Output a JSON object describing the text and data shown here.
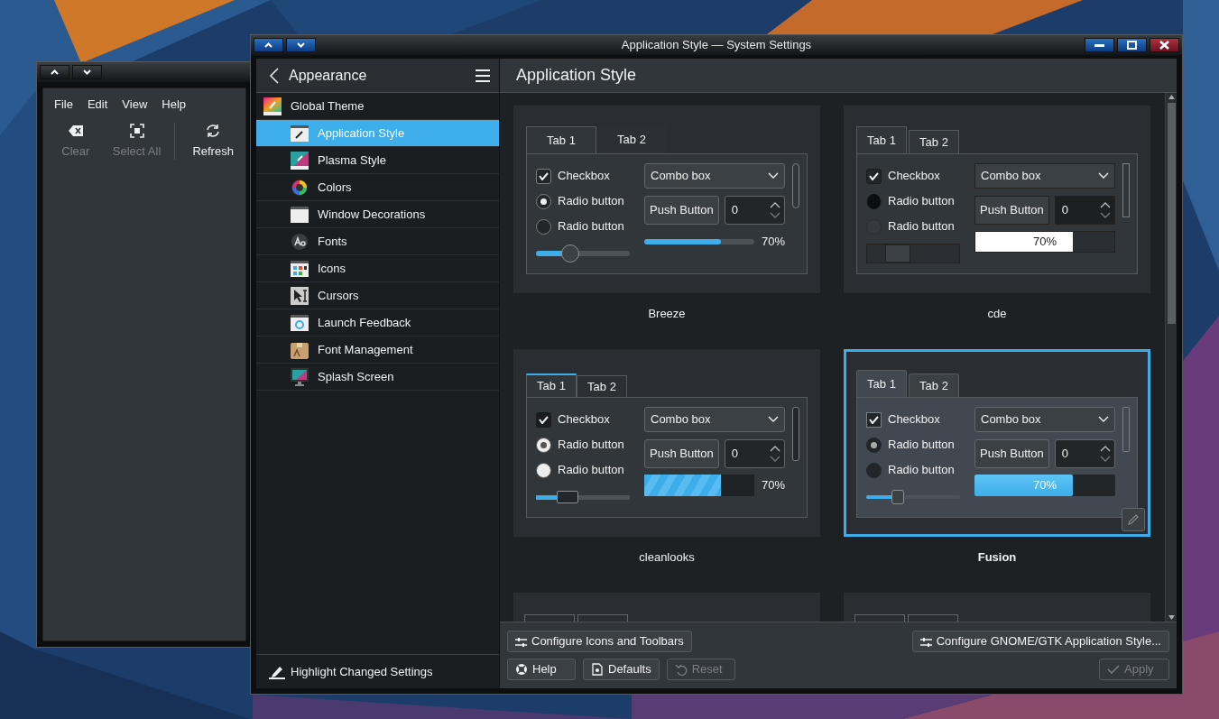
{
  "back_window": {
    "menu": [
      "File",
      "Edit",
      "View",
      "Help"
    ],
    "toolbar": [
      {
        "label": "Clear",
        "disabled": true
      },
      {
        "label": "Select All",
        "disabled": true
      },
      {
        "label": "Refresh",
        "disabled": false
      }
    ]
  },
  "window": {
    "title": "Application Style — System Settings"
  },
  "sidebar": {
    "title": "Appearance",
    "items": [
      {
        "label": "Global Theme",
        "selected": false,
        "children": [
          {
            "label": "Application Style",
            "selected": true
          },
          {
            "label": "Plasma Style",
            "selected": false
          },
          {
            "label": "Colors",
            "selected": false
          },
          {
            "label": "Window Decorations",
            "selected": false
          },
          {
            "label": "Fonts",
            "selected": false
          },
          {
            "label": "Icons",
            "selected": false
          },
          {
            "label": "Cursors",
            "selected": false
          },
          {
            "label": "Launch Feedback",
            "selected": false
          },
          {
            "label": "Font Management",
            "selected": false
          },
          {
            "label": "Splash Screen",
            "selected": false
          }
        ]
      }
    ],
    "footer_button": "Highlight Changed Settings"
  },
  "page_title": "Application Style",
  "styles": [
    {
      "kind": "breeze",
      "name": "Breeze",
      "selected": false,
      "tabs": [
        {
          "label": "Tab 1",
          "selected": true
        },
        {
          "label": "Tab 2",
          "selected": false
        }
      ],
      "checkbox": {
        "label": "Checkbox",
        "checked": true
      },
      "radios": [
        {
          "label": "Radio button",
          "selected": true
        },
        {
          "label": "Radio button",
          "selected": false
        }
      ],
      "slider": {
        "level": 0.33
      },
      "combo": "Combo box",
      "button": "Push Button",
      "spin": "0",
      "progress": {
        "level": 0.7,
        "reading": "70%"
      }
    },
    {
      "kind": "cde",
      "name": "cde",
      "selected": false,
      "tabs": [
        {
          "label": "Tab 1",
          "selected": true
        },
        {
          "label": "Tab 2",
          "selected": false
        }
      ],
      "checkbox": {
        "label": "Checkbox",
        "checked": true
      },
      "radios": [
        {
          "label": "Radio button",
          "selected": true
        },
        {
          "label": "Radio button",
          "selected": false
        }
      ],
      "slider": {
        "level": 0.3
      },
      "combo": "Combo box",
      "button": "Push Button",
      "spin": "0",
      "progress": {
        "level": 0.7,
        "reading": "70%"
      }
    },
    {
      "kind": "cleanlooks",
      "name": "cleanlooks",
      "selected": false,
      "tabs": [
        {
          "label": "Tab 1",
          "selected": true
        },
        {
          "label": "Tab 2",
          "selected": false
        }
      ],
      "checkbox": {
        "label": "Checkbox",
        "checked": true
      },
      "radios": [
        {
          "label": "Radio button",
          "selected": true
        },
        {
          "label": "Radio button",
          "selected": false
        }
      ],
      "slider": {
        "level": 0.3
      },
      "combo": "Combo box",
      "button": "Push Button",
      "spin": "0",
      "progress": {
        "level": 0.7,
        "reading": "70%"
      }
    },
    {
      "kind": "fusion",
      "name": "Fusion",
      "selected": true,
      "tabs": [
        {
          "label": "Tab 1",
          "selected": true
        },
        {
          "label": "Tab 2",
          "selected": false
        }
      ],
      "checkbox": {
        "label": "Checkbox",
        "checked": true
      },
      "radios": [
        {
          "label": "Radio button",
          "selected": true
        },
        {
          "label": "Radio button",
          "selected": false
        }
      ],
      "slider": {
        "level": 0.3
      },
      "combo": "Combo box",
      "button": "Push Button",
      "spin": "0",
      "progress": {
        "level": 0.7,
        "reading": "70%"
      }
    },
    {
      "kind": "partial",
      "selected": false
    },
    {
      "kind": "partial",
      "selected": false
    }
  ],
  "config_buttons": [
    "Configure Icons and Toolbars",
    "Configure GNOME/GTK Application Style..."
  ],
  "buttons": [
    {
      "kind": "help",
      "label": "Help",
      "disabled": false
    },
    {
      "kind": "defaults",
      "label": "Defaults",
      "disabled": false
    },
    {
      "kind": "reset",
      "label": "Reset",
      "disabled": true
    },
    {
      "kind": "apply",
      "label": "Apply",
      "disabled": true
    }
  ]
}
